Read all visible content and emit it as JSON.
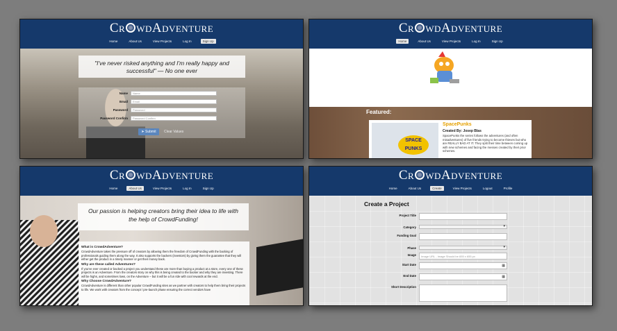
{
  "brand": {
    "logo_pre": "Cr",
    "logo_post": "wdAdventure"
  },
  "panels": {
    "home": {
      "nav": [
        "Home",
        "About Us",
        "View Projects",
        "Log In",
        "Sign Up"
      ],
      "quote": "\"I've never risked anything and I'm really happy and successful\" — No one ever",
      "form": {
        "labels": [
          "Name",
          "Email",
          "Password",
          "Password Confirm"
        ],
        "placeholders": [
          "Name",
          "Email",
          "Password",
          "Password Confirm"
        ],
        "submit": "Submit",
        "clear": "Clear Values"
      }
    },
    "featured": {
      "nav": [
        "Home",
        "About Us",
        "View Projects",
        "Log In",
        "Sign Up"
      ],
      "featured_label": "Featured:",
      "card": {
        "logo_text": "SPACE PUNKS",
        "title": "SpacePunks",
        "author": "Created By: Josep Blas",
        "description": "SpacePunks the series follows the adventures (and often misadventures) of five friends trying to become thieves but who are REALLY BAD AT IT. They split their time between coming up with new schemes and facing the messes created by their prior schemes."
      }
    },
    "about": {
      "nav": [
        "Home",
        "About Us",
        "View Projects",
        "Log In",
        "Sign Up"
      ],
      "quote": "Our passion is helping creators bring their idea to life with the help of CrowdFunding!",
      "sections": [
        {
          "heading": "What is CrowdAdventure?",
          "body": "CrowdAdventure takes the pressure off of creators by allowing them the freedom of CrowdFunding with the backing of professionals guiding them along the way. It also supports the backers (investors) by giving them the guarantee that they will either get the product in a timely manner or get their money back."
        },
        {
          "heading": "Why are these called Adventures?",
          "body": "If you've ever created or backed a project you understand these are more than buying a product at a store, every one of these projects is an Adventure. From the creators story on why this is being created to the backer and why they are investing. There will be highs, and sometimes lows, on the Adventure – but it will be a fun ride with cool rewards at the end."
        },
        {
          "heading": "Why Choose CrowdAdventure?",
          "body": "CrowdAdventure is different than other popular CrowdFunding sites as we partner with creators to help them bring their projects to life. We work with creators from the concept / pre-launch phase ensuring the correct vendors have"
        }
      ]
    },
    "create": {
      "nav": [
        "Home",
        "About Us",
        "Create",
        "View Projects",
        "Logout",
        "Profile"
      ],
      "title": "Create a Project",
      "fields": [
        "Project Title",
        "Category",
        "Funding Goal",
        "Phase",
        "Image",
        "Start Date",
        "End Date",
        "Short Description"
      ],
      "image_placeholder": "Image URL - Image Should be 655 x 655 px"
    }
  }
}
